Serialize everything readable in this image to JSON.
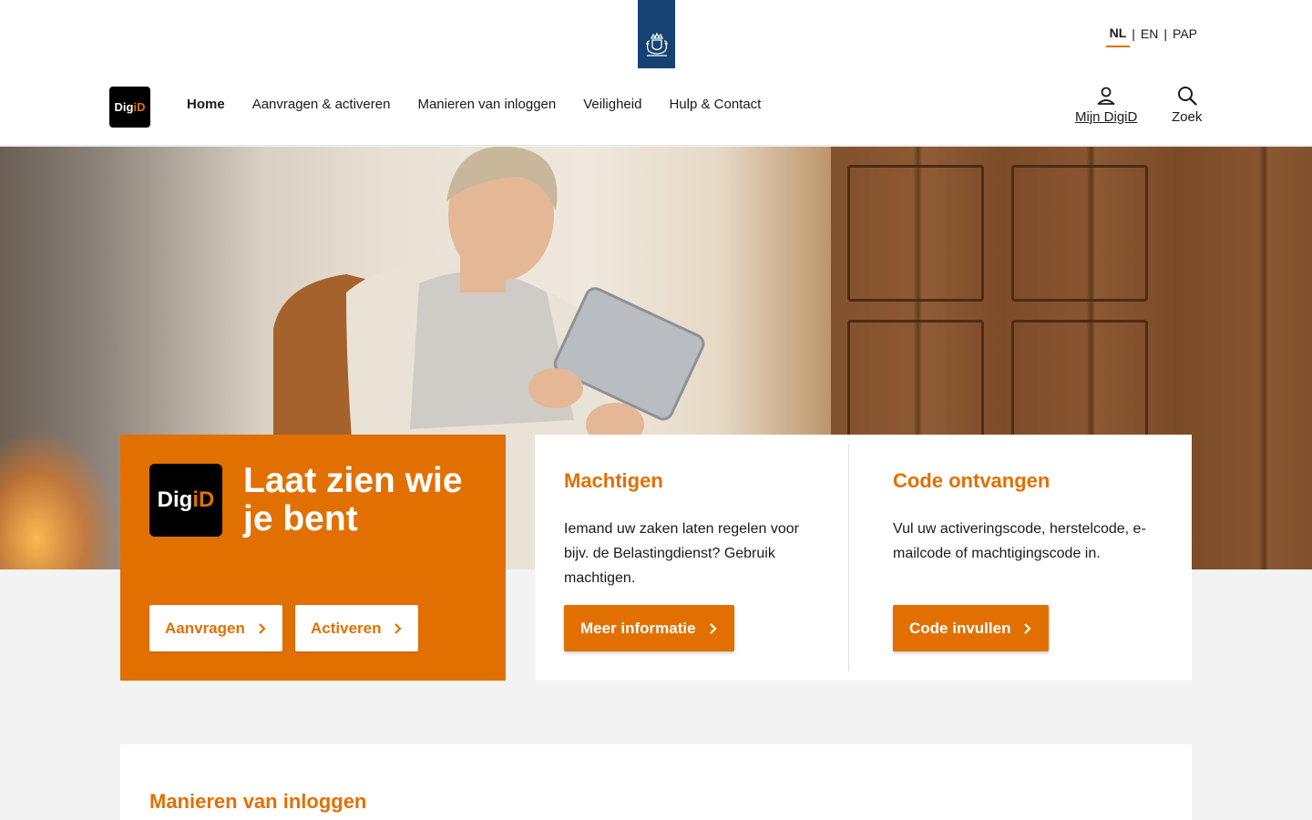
{
  "header": {
    "languages": [
      {
        "label": "NL",
        "active": true
      },
      {
        "label": "EN",
        "active": false
      },
      {
        "label": "PAP",
        "active": false
      }
    ],
    "separator": "|",
    "logo": {
      "text_a": "Dig",
      "text_b": "iD"
    },
    "nav": [
      {
        "label": "Home",
        "active": true
      },
      {
        "label": "Aanvragen & activeren",
        "active": false
      },
      {
        "label": "Manieren van inloggen",
        "active": false
      },
      {
        "label": "Veiligheid",
        "active": false
      },
      {
        "label": "Hulp & Contact",
        "active": false
      }
    ],
    "mijn_digid": "Mijn DigiD",
    "zoek": "Zoek"
  },
  "hero_card": {
    "logo_a": "Dig",
    "logo_b": "iD",
    "title": "Laat zien wie je bent",
    "buttons": [
      "Aanvragen",
      "Activeren"
    ]
  },
  "machtigen": {
    "title": "Machtigen",
    "text": "Iemand uw zaken laten regelen voor bijv. de Belastingdienst? Gebruik machtigen.",
    "button": "Meer informatie"
  },
  "code": {
    "title": "Code ontvangen",
    "text": "Vul uw activeringscode, herstelcode, e-mailcode of machtigingscode in.",
    "button": "Code invullen"
  },
  "bottom_section": {
    "title": "Manieren van inloggen"
  },
  "colors": {
    "brand_orange": "#e17000",
    "gov_blue": "#154273"
  },
  "icons": [
    "rijksoverheid-logo-icon",
    "user-icon",
    "search-icon",
    "chevron-right-icon"
  ]
}
